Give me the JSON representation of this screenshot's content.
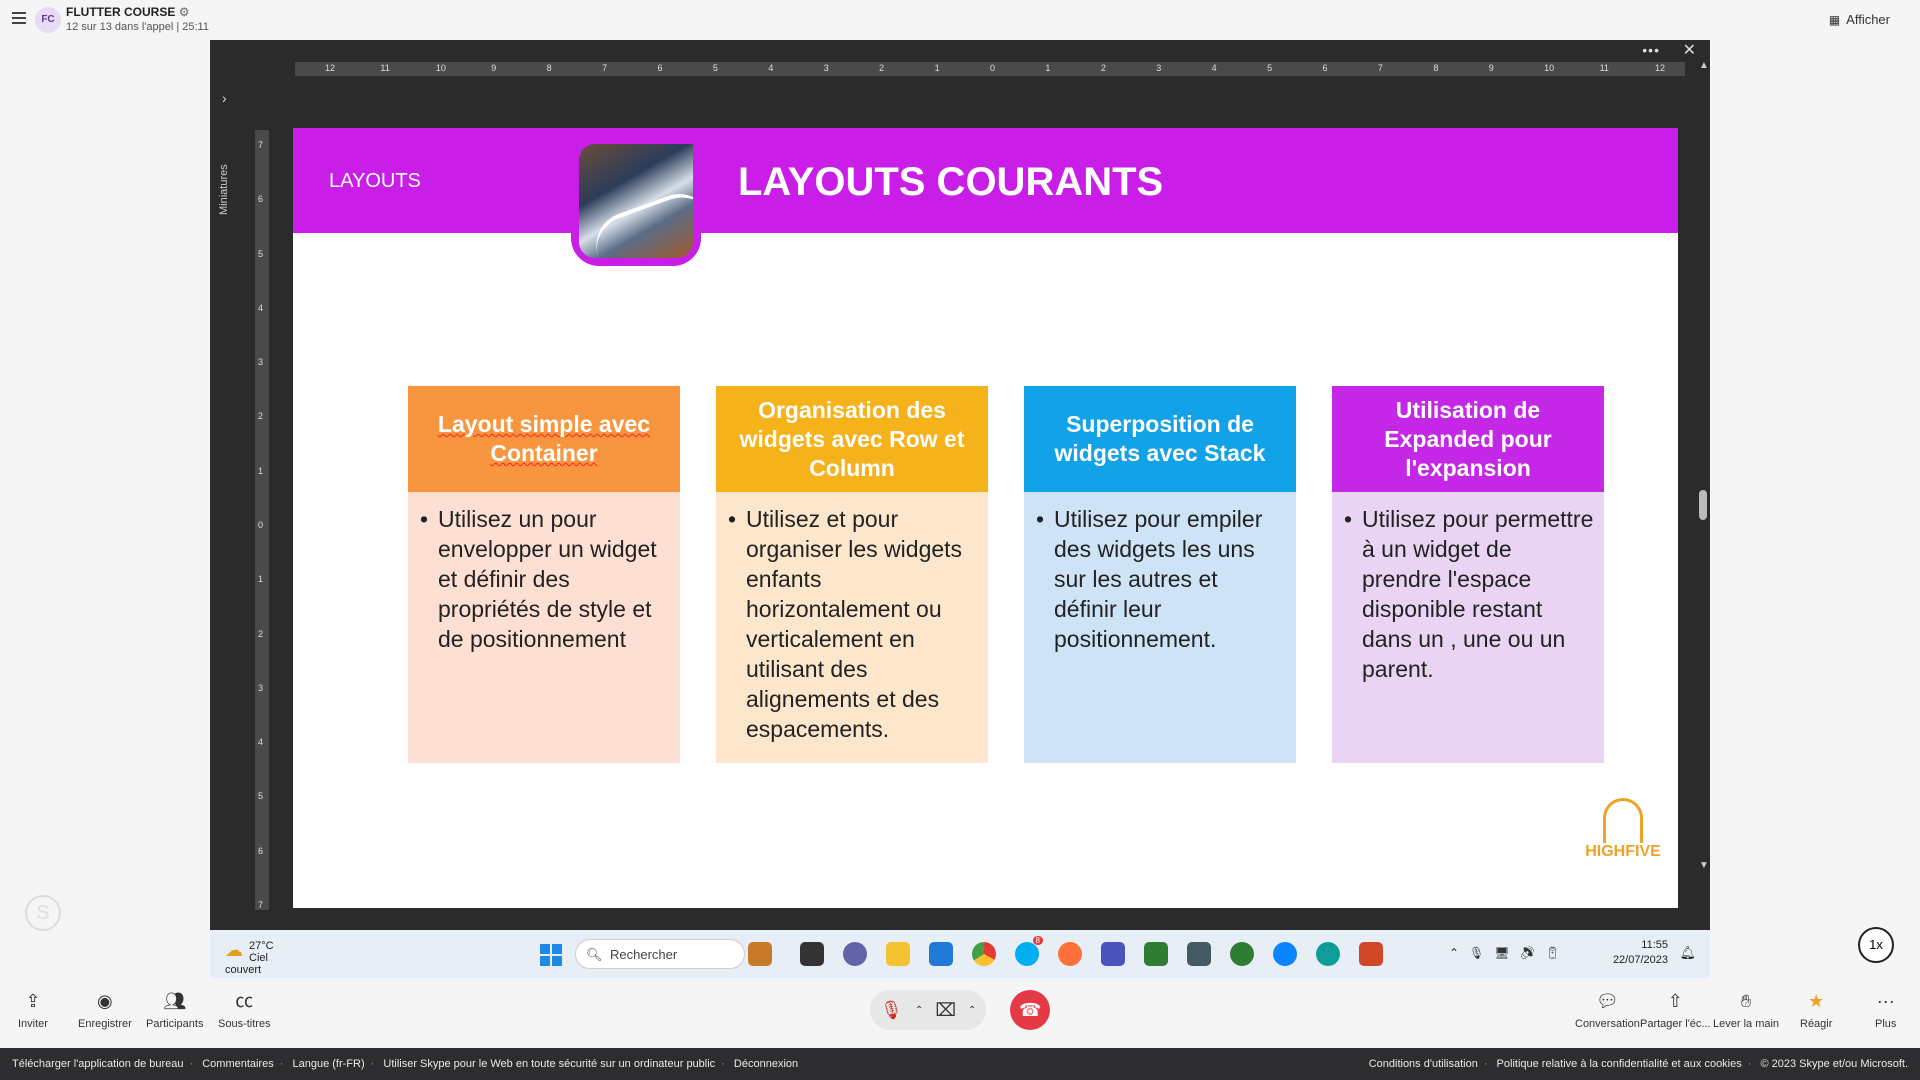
{
  "topbar": {
    "avatar_initials": "FC",
    "call_title": "FLUTTER COURSE",
    "call_subtitle": "12 sur 13 dans l'appel | 25:11",
    "view_button": "Afficher"
  },
  "share": {
    "thumbnails_label": "Miniatures",
    "more_icon": "more-horizontal-icon",
    "close_icon": "close-icon",
    "ruler_h": [
      "12",
      "11",
      "10",
      "9",
      "8",
      "7",
      "6",
      "5",
      "4",
      "3",
      "2",
      "1",
      "0",
      "1",
      "2",
      "3",
      "4",
      "5",
      "6",
      "7",
      "8",
      "9",
      "10",
      "11",
      "12"
    ],
    "ruler_v": [
      "7",
      "6",
      "5",
      "4",
      "3",
      "2",
      "1",
      "0",
      "1",
      "2",
      "3",
      "4",
      "5",
      "6",
      "7"
    ]
  },
  "slide": {
    "tag": "LAYOUTS",
    "title": "LAYOUTS COURANTS",
    "header_color": "#c81ee8",
    "cards": [
      {
        "title": "Layout simple avec Container",
        "head_color": "#f7963f",
        "body_color": "#fde0d3",
        "bullet": "Utilisez un pour envelopper un widget et définir des propriétés de style et de positionnement"
      },
      {
        "title": "Organisation des widgets avec Row et Column",
        "head_color": "#f6b21b",
        "body_color": "#fde7cc",
        "bullet": "Utilisez et pour organiser les widgets enfants horizontalement ou verticalement en utilisant des alignements et des espacements."
      },
      {
        "title": "Superposition de widgets avec Stack",
        "head_color": "#12a2e8",
        "body_color": "#cfe3f7",
        "bullet": "Utilisez pour empiler des widgets les uns sur les autres et définir leur positionnement."
      },
      {
        "title": "Utilisation de Expanded pour l'expansion",
        "head_color": "#c427e6",
        "body_color": "#ead4f4",
        "bullet": "Utilisez pour permettre à un widget de prendre l'espace disponible restant dans un , une ou un parent."
      }
    ],
    "logo_text": "HIGHFIVE"
  },
  "taskbar": {
    "temperature": "27°C",
    "weather": "Ciel couvert",
    "search_placeholder": "Rechercher",
    "time": "11:55",
    "date": "22/07/2023",
    "skype_badge": "8"
  },
  "controls": {
    "invite": "Inviter",
    "record": "Enregistrer",
    "participants": "Participants",
    "subtitles": "Sous-titres",
    "conversation": "Conversation",
    "share": "Partager l'éc...",
    "raise_hand": "Lever la main",
    "react": "Réagir",
    "more": "Plus",
    "speed": "1x"
  },
  "footer": {
    "left": [
      "Télécharger l'application de bureau",
      "Commentaires",
      "Langue (fr-FR)",
      "Utiliser Skype pour le Web en toute sécurité sur un ordinateur public",
      "Déconnexion"
    ],
    "right": [
      "Conditions d'utilisation",
      "Politique relative à la confidentialité et aux cookies",
      "© 2023 Skype et/ou Microsoft."
    ]
  }
}
